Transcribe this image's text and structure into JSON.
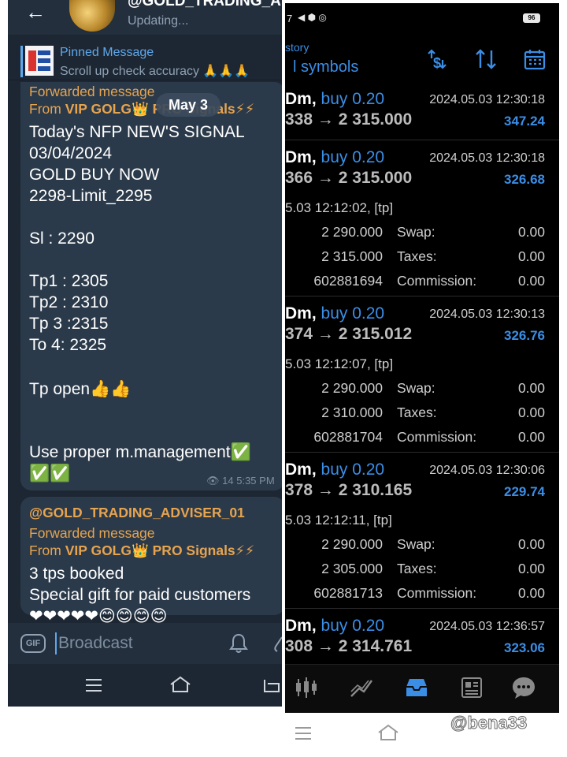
{
  "telegram": {
    "header": {
      "title": "@GOLD_TRADING_AD",
      "status": "Updating..."
    },
    "pinned": {
      "title": "Pinned Message",
      "text": "Scroll up check accuracy 🙏🙏🙏"
    },
    "date_chip": "May 3",
    "message1": {
      "forwarded_label": "Forwarded message",
      "from_prefix": "From ",
      "from_name": "VIP GOLG👑 PRO Signals⚡⚡",
      "lines": [
        "Today's NFP NEW'S SIGNAL",
        "03/04/2024",
        "GOLD BUY NOW",
        "2298-Limit_2295",
        "Sl : 2290",
        "Tp1 : 2305",
        "Tp2 : 2310",
        "Tp 3 :2315",
        "To 4: 2325",
        "Tp  open👍👍",
        "Use proper m.management✅",
        "✅✅"
      ],
      "views": "14",
      "time": "5:35 PM"
    },
    "message2": {
      "author": "@GOLD_TRADING_ADVISER_01",
      "forwarded_label": "Forwarded message",
      "from_prefix": "From ",
      "from_name": "VIP GOLG👑 PRO Signals⚡⚡",
      "lines": [
        "3 tps booked",
        "Special gift for paid customers",
        "❤❤❤❤❤😊😊😊😊"
      ]
    },
    "input": {
      "placeholder": "Broadcast",
      "gif_label": "GIF"
    }
  },
  "mt5": {
    "status_time": "7",
    "battery": "96",
    "header": {
      "section": "story",
      "title": "l symbols"
    },
    "trades": [
      {
        "symbol": "Dm,",
        "side": "buy 0.20",
        "time": "2024.05.03 12:30:18",
        "price": "338 → 2 315.000",
        "profit": "347.24",
        "expanded": false
      },
      {
        "symbol": "Dm,",
        "side": "buy 0.20",
        "time": "2024.05.03 12:30:18",
        "price": "366 → 2 315.000",
        "profit": "326.68",
        "expanded": true,
        "open": "5.03 12:12:02, [tp]",
        "rows": [
          [
            "2 290.000",
            "Swap:",
            "0.00"
          ],
          [
            "2 315.000",
            "Taxes:",
            "0.00"
          ],
          [
            "602881694",
            "Commission:",
            "0.00"
          ]
        ]
      },
      {
        "symbol": "Dm,",
        "side": "buy 0.20",
        "time": "2024.05.03 12:30:13",
        "price": "374 → 2 315.012",
        "profit": "326.76",
        "expanded": true,
        "open": "5.03 12:12:07, [tp]",
        "rows": [
          [
            "2 290.000",
            "Swap:",
            "0.00"
          ],
          [
            "2 310.000",
            "Taxes:",
            "0.00"
          ],
          [
            "602881704",
            "Commission:",
            "0.00"
          ]
        ]
      },
      {
        "symbol": "Dm,",
        "side": "buy 0.20",
        "time": "2024.05.03 12:30:06",
        "price": "378 → 2 310.165",
        "profit": "229.74",
        "expanded": true,
        "open": "5.03 12:12:11, [tp]",
        "rows": [
          [
            "2 290.000",
            "Swap:",
            "0.00"
          ],
          [
            "2 305.000",
            "Taxes:",
            "0.00"
          ],
          [
            "602881713",
            "Commission:",
            "0.00"
          ]
        ]
      },
      {
        "symbol": "Dm,",
        "side": "buy 0.20",
        "time": "2024.05.03 12:36:57",
        "price": "308 → 2 314.761",
        "profit": "323.06",
        "expanded": false
      }
    ]
  },
  "watermark": "@bena33",
  "colors": {
    "telegram_bg": "#1d2733",
    "bubble": "#2b3a4a",
    "accent_orange": "#e7a44f",
    "mt_blue": "#3a8ee6"
  }
}
